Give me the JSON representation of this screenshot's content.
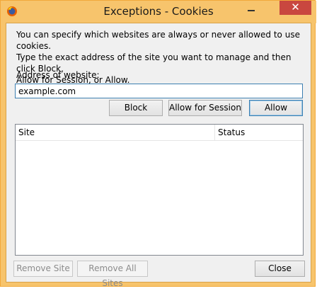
{
  "window": {
    "title": "Exceptions - Cookies",
    "close_glyph": "✕"
  },
  "intro_text": "You can specify which websites are always or never allowed to use cookies.\nType the exact address of the site you want to manage and then click Block,\nAllow for Session, or Allow.",
  "address": {
    "label": "Address of website:",
    "value": "example.com"
  },
  "actions": {
    "block": "Block",
    "allow_session": "Allow for Session",
    "allow": "Allow"
  },
  "table": {
    "columns": [
      "Site",
      "Status"
    ],
    "rows": []
  },
  "footer": {
    "remove_site": "Remove Site",
    "remove_all": "Remove All Sites",
    "close": "Close"
  },
  "colors": {
    "titlebar": "#f7c46c",
    "close_button": "#c9473f",
    "focus_border": "#3c7fb1"
  }
}
